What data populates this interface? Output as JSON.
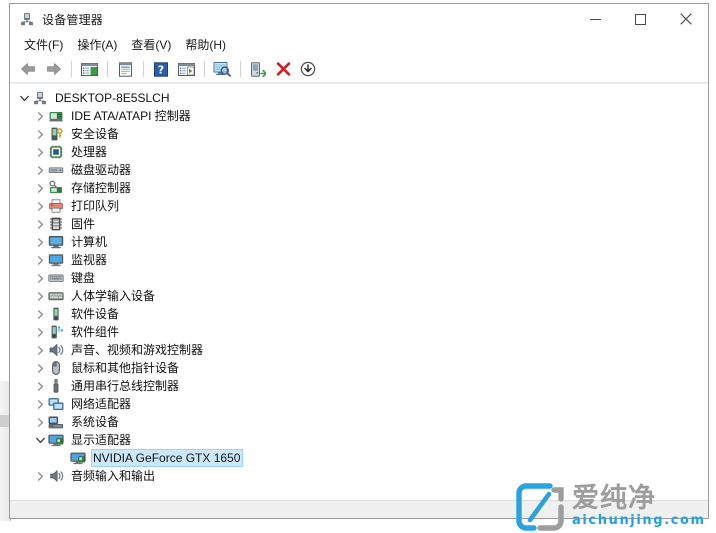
{
  "window": {
    "title": "设备管理器",
    "title_icon": "device-manager-icon",
    "controls": {
      "minimize": "−",
      "maximize": "□",
      "close": "✕"
    }
  },
  "menubar": {
    "items": [
      {
        "label": "文件(F)",
        "name": "menu-file"
      },
      {
        "label": "操作(A)",
        "name": "menu-action"
      },
      {
        "label": "查看(V)",
        "name": "menu-view"
      },
      {
        "label": "帮助(H)",
        "name": "menu-help"
      }
    ]
  },
  "toolbar": {
    "buttons": [
      {
        "icon": "back-arrow-icon",
        "name": "toolbar-back"
      },
      {
        "icon": "forward-arrow-icon",
        "name": "toolbar-forward"
      },
      {
        "icon": "separator",
        "name": "toolbar-separator-1"
      },
      {
        "icon": "tree-view-icon",
        "name": "toolbar-show-hide-tree"
      },
      {
        "icon": "separator",
        "name": "toolbar-separator-2"
      },
      {
        "icon": "properties-icon",
        "name": "toolbar-properties"
      },
      {
        "icon": "separator",
        "name": "toolbar-separator-3"
      },
      {
        "icon": "help-icon",
        "name": "toolbar-help"
      },
      {
        "icon": "console-icon",
        "name": "toolbar-console"
      },
      {
        "icon": "separator",
        "name": "toolbar-separator-4"
      },
      {
        "icon": "scan-hardware-icon",
        "name": "toolbar-scan-hardware-changes"
      },
      {
        "icon": "separator",
        "name": "toolbar-separator-5"
      },
      {
        "icon": "update-driver-icon",
        "name": "toolbar-update-driver"
      },
      {
        "icon": "uninstall-device-icon",
        "name": "toolbar-uninstall-device"
      },
      {
        "icon": "disable-device-icon",
        "name": "toolbar-disable-device"
      }
    ]
  },
  "tree": {
    "nodes": [
      {
        "label": "DESKTOP-8E5SLCH",
        "level": 0,
        "state": "expanded",
        "icon": "computer-root-icon",
        "selected": false
      },
      {
        "label": "IDE ATA/ATAPI 控制器",
        "level": 1,
        "state": "collapsed",
        "icon": "ide-controller-icon",
        "selected": false
      },
      {
        "label": "安全设备",
        "level": 1,
        "state": "collapsed",
        "icon": "security-device-icon",
        "selected": false
      },
      {
        "label": "处理器",
        "level": 1,
        "state": "collapsed",
        "icon": "processor-icon",
        "selected": false
      },
      {
        "label": "磁盘驱动器",
        "level": 1,
        "state": "collapsed",
        "icon": "disk-drive-icon",
        "selected": false
      },
      {
        "label": "存储控制器",
        "level": 1,
        "state": "collapsed",
        "icon": "storage-controller-icon",
        "selected": false
      },
      {
        "label": "打印队列",
        "level": 1,
        "state": "collapsed",
        "icon": "print-queue-icon",
        "selected": false
      },
      {
        "label": "固件",
        "level": 1,
        "state": "collapsed",
        "icon": "firmware-icon",
        "selected": false
      },
      {
        "label": "计算机",
        "level": 1,
        "state": "collapsed",
        "icon": "computer-icon",
        "selected": false
      },
      {
        "label": "监视器",
        "level": 1,
        "state": "collapsed",
        "icon": "monitor-icon",
        "selected": false
      },
      {
        "label": "键盘",
        "level": 1,
        "state": "collapsed",
        "icon": "keyboard-icon",
        "selected": false
      },
      {
        "label": "人体学输入设备",
        "level": 1,
        "state": "collapsed",
        "icon": "hid-icon",
        "selected": false
      },
      {
        "label": "软件设备",
        "level": 1,
        "state": "collapsed",
        "icon": "software-device-icon",
        "selected": false
      },
      {
        "label": "软件组件",
        "level": 1,
        "state": "collapsed",
        "icon": "software-component-icon",
        "selected": false
      },
      {
        "label": "声音、视频和游戏控制器",
        "level": 1,
        "state": "collapsed",
        "icon": "sound-video-game-icon",
        "selected": false
      },
      {
        "label": "鼠标和其他指针设备",
        "level": 1,
        "state": "collapsed",
        "icon": "mouse-icon",
        "selected": false
      },
      {
        "label": "通用串行总线控制器",
        "level": 1,
        "state": "collapsed",
        "icon": "usb-controller-icon",
        "selected": false
      },
      {
        "label": "网络适配器",
        "level": 1,
        "state": "collapsed",
        "icon": "network-adapter-icon",
        "selected": false
      },
      {
        "label": "系统设备",
        "level": 1,
        "state": "collapsed",
        "icon": "system-device-icon",
        "selected": false
      },
      {
        "label": "显示适配器",
        "level": 1,
        "state": "expanded",
        "icon": "display-adapter-icon",
        "selected": false
      },
      {
        "label": "NVIDIA GeForce GTX 1650",
        "level": 2,
        "state": "leaf",
        "icon": "display-adapter-icon",
        "selected": true
      },
      {
        "label": "音频输入和输出",
        "level": 1,
        "state": "collapsed",
        "icon": "audio-io-icon",
        "selected": false
      }
    ]
  },
  "watermark": {
    "cn_text": "爱纯净",
    "en_text": "aichunjing.com",
    "logo_icon": "aichunjing-logo-icon",
    "accent_color": "#1ea2e8",
    "gray_color": "#9d9d9d"
  },
  "colors": {
    "selection_bg": "#cce8ff",
    "selection_border": "#99d1ff",
    "window_border": "#9a9a9a",
    "content_bg": "#ffffff"
  }
}
